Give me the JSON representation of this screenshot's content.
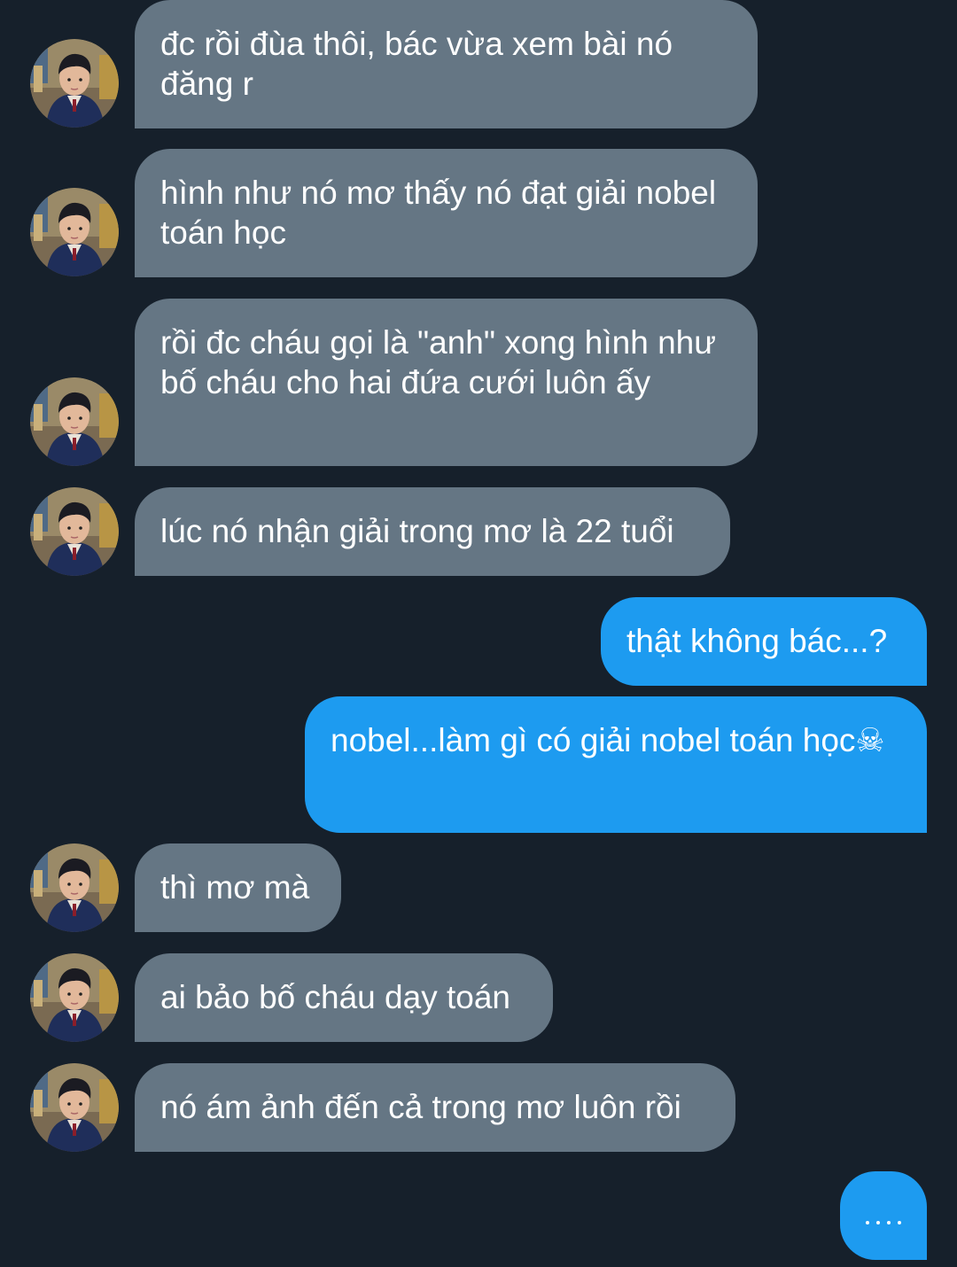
{
  "conversation": {
    "messages": [
      {
        "sender": "other",
        "text": "đc rồi đùa thôi, bác vừa xem bài nó đăng r"
      },
      {
        "sender": "other",
        "text": "hình như nó mơ thấy nó đạt giải nobel toán học"
      },
      {
        "sender": "other",
        "text": "rồi đc cháu gọi là \"anh\" xong hình như bố cháu cho hai đứa cưới luôn ấy"
      },
      {
        "sender": "other",
        "text": "lúc nó nhận giải trong mơ là 22 tuổi"
      },
      {
        "sender": "me",
        "text": "thật không bác...?"
      },
      {
        "sender": "me",
        "text": "nobel...làm gì có giải nobel toán học☠"
      },
      {
        "sender": "other",
        "text": "thì mơ mà"
      },
      {
        "sender": "other",
        "text": "ai bảo bố cháu dạy toán"
      },
      {
        "sender": "other",
        "text": "nó ám ảnh đến cả trong mơ luôn rồi"
      }
    ],
    "typing_indicator": "…."
  },
  "colors": {
    "background": "#16202b",
    "incoming_bubble": "#657684",
    "outgoing_bubble": "#1d9bf0",
    "text": "#ffffff"
  },
  "icons": {
    "avatar": "avatar-photo-icon",
    "typing": "typing-dots-icon"
  }
}
